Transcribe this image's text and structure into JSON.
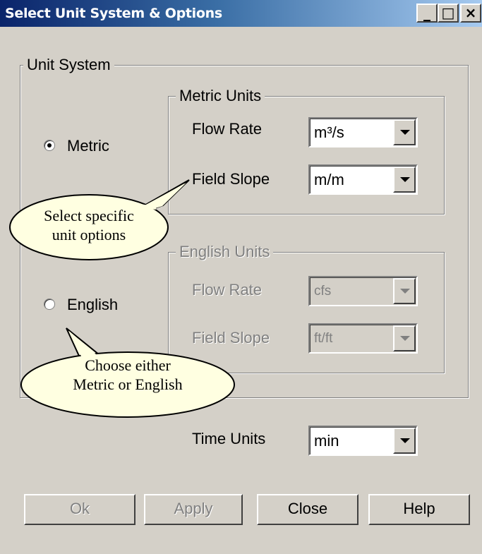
{
  "window": {
    "title": "Select Unit System & Options",
    "controls": {
      "minimize": "_",
      "maximize": "□",
      "close": "×"
    }
  },
  "unit_system": {
    "legend": "Unit System",
    "metric_radio": {
      "label": "Metric",
      "checked": true
    },
    "english_radio": {
      "label": "English",
      "checked": false
    }
  },
  "metric_units": {
    "legend": "Metric Units",
    "flow_rate": {
      "label": "Flow Rate",
      "value": "m³/s"
    },
    "field_slope": {
      "label": "Field Slope",
      "value": "m/m"
    }
  },
  "english_units": {
    "legend": "English Units",
    "flow_rate": {
      "label": "Flow Rate",
      "value": "cfs"
    },
    "field_slope": {
      "label": "Field Slope",
      "value": "ft/ft"
    }
  },
  "time_units": {
    "label": "Time Units",
    "value": "min"
  },
  "buttons": {
    "ok": "Ok",
    "apply": "Apply",
    "close": "Close",
    "help": "Help"
  },
  "callouts": {
    "unit_options": {
      "line1": "Select specific",
      "line2": "unit options"
    },
    "metric_or_english": {
      "line1": "Choose either",
      "line2": "Metric or English"
    }
  },
  "colors": {
    "dialog_bg": "#d4d0c8",
    "title_gradient_start": "#0a246a",
    "title_gradient_end": "#a6caf0",
    "callout_fill": "#ffffe1"
  }
}
